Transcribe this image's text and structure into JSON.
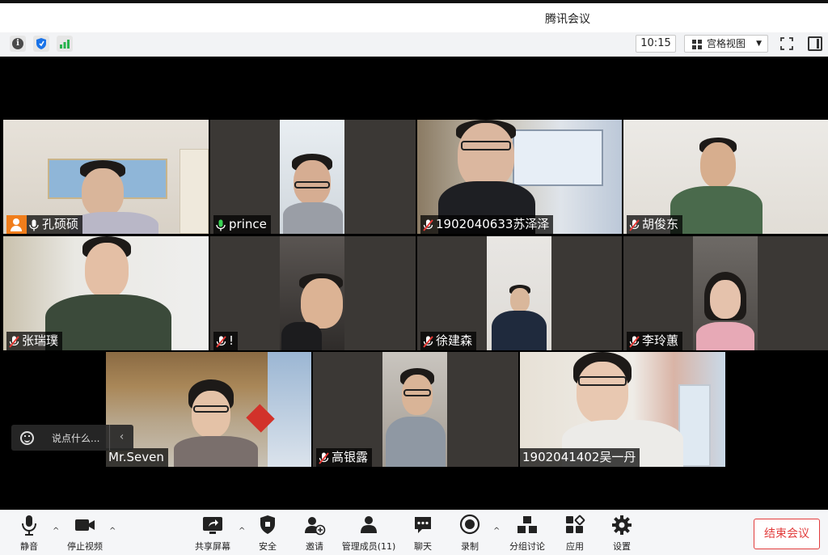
{
  "window": {
    "title": "腾讯会议"
  },
  "topbar": {
    "time": "10:15",
    "view_label": "宫格视图"
  },
  "participants": [
    {
      "name": "孔硕硕",
      "mic": "on",
      "host": true
    },
    {
      "name": "prince",
      "mic": "on"
    },
    {
      "name": "1902040633苏泽泽",
      "mic": "muted"
    },
    {
      "name": "胡俊东",
      "mic": "muted"
    },
    {
      "name": "张瑞璞",
      "mic": "muted"
    },
    {
      "name": "!",
      "mic": "muted"
    },
    {
      "name": "徐建森",
      "mic": "muted"
    },
    {
      "name": "李玲蕙",
      "mic": "muted"
    },
    {
      "name": "Mr.Seven",
      "mic": "none"
    },
    {
      "name": "高银露",
      "mic": "muted"
    },
    {
      "name": "1902041402吴一丹",
      "mic": "none"
    }
  ],
  "chat": {
    "placeholder": "说点什么..."
  },
  "controls": {
    "mute": "静音",
    "stop_video": "停止视频",
    "share_screen": "共享屏幕",
    "security": "安全",
    "invite": "邀请",
    "manage_members": "管理成员(11)",
    "chat": "聊天",
    "record": "录制",
    "breakout": "分组讨论",
    "apps": "应用",
    "settings": "设置",
    "end_meeting": "结束会议"
  },
  "colors": {
    "accent": "#1a73e8",
    "end": "#e23c3c",
    "speaking": "#27c24c",
    "host": "#f07d1b",
    "muted": "#e53935"
  }
}
